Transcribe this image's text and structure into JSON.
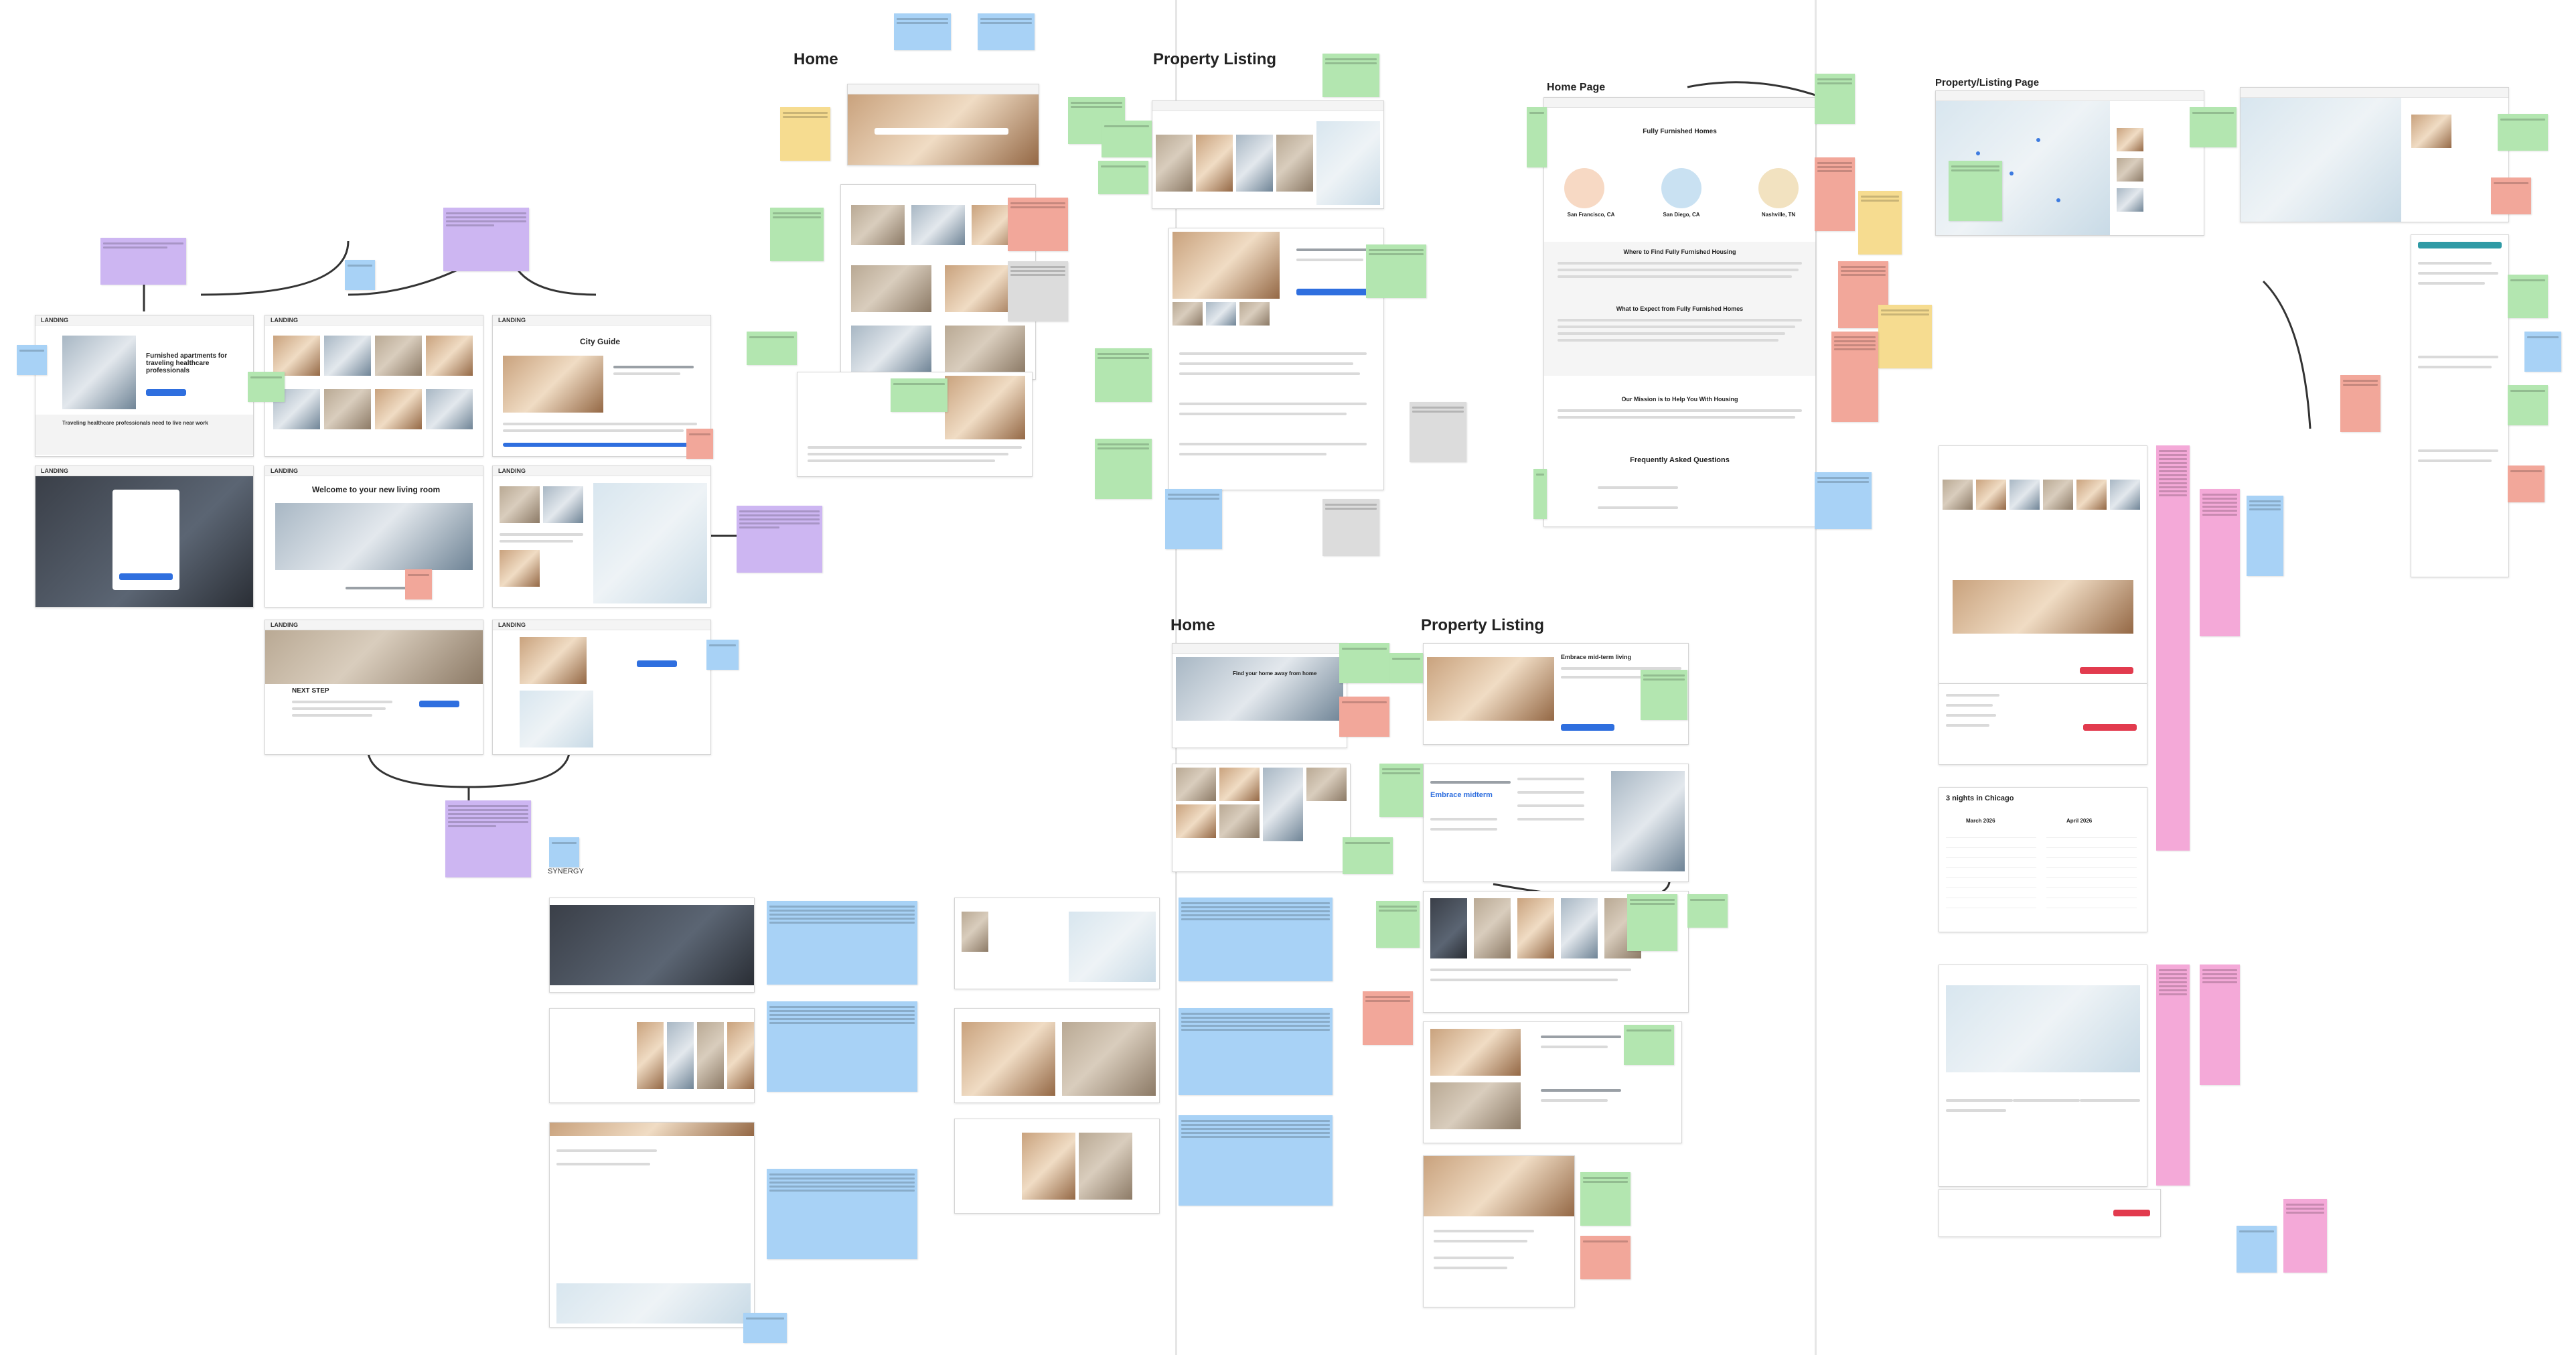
{
  "sections": {
    "home_a": "Home",
    "listing_a": "Property Listing",
    "home_b": "Home",
    "listing_b": "Property Listing",
    "home_page": "Home Page",
    "listing_page": "Property/Listing Page"
  },
  "landing": {
    "label": "LANDING",
    "hero_heading_1": "Furnished apartments for traveling healthcare professionals",
    "hero_subtext_1": "Traveling healthcare professionals need to live near work",
    "hero_heading_2": "City Guide",
    "hero_heading_3": "Welcome to your new living room",
    "hero_heading_4": "NEXT STEP",
    "synergy_label": "SYNERGY"
  },
  "home_page": {
    "title": "Fully Furnished Homes",
    "cities": [
      "San Francisco, CA",
      "San Diego, CA",
      "Nashville, TN"
    ],
    "section_1": "Where to Find Fully Furnished Housing",
    "section_2": "What to Expect from Fully Furnished Homes",
    "section_3": "Our Mission is to Help You With Housing",
    "faq_title": "Frequently Asked Questions"
  },
  "listing_page": {
    "calendar_title": "3 nights in Chicago",
    "months": [
      "March 2026",
      "April 2026"
    ],
    "featured_title": "Embrace mid-term living",
    "home_b_heading": "Find your home away from home"
  },
  "colors": {
    "purple_note": "#cdb6f2",
    "blue_note": "#a8d2f6",
    "green_note": "#b3e6b0",
    "pink_note": "#f4a9d8",
    "salmon_note": "#f2a79a",
    "yellow_note": "#f6dc90"
  }
}
